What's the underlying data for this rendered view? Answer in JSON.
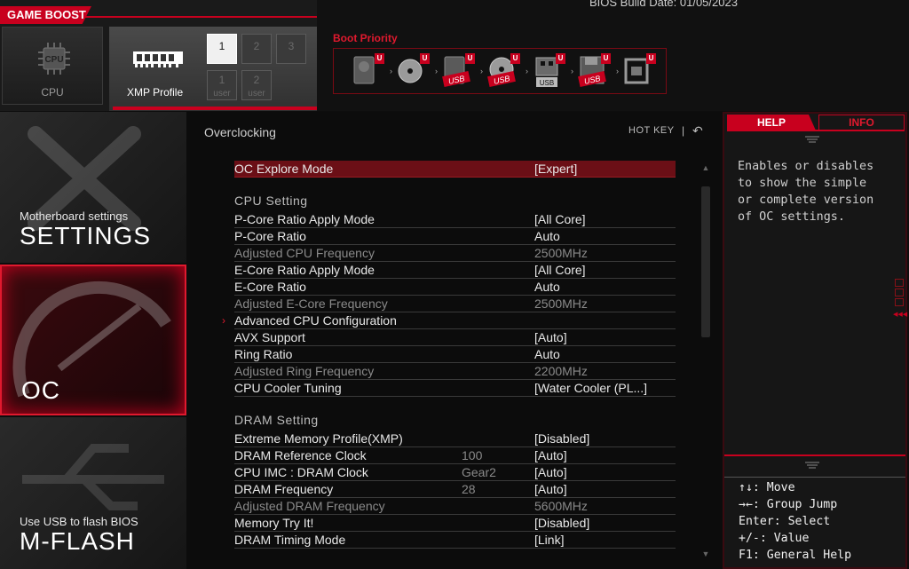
{
  "header": {
    "game_boost_label": "GAME BOOST",
    "build_date": "BIOS Build Date: 01/05/2023",
    "cpu_tile_label": "CPU",
    "cpu_chip_text": "CPU",
    "xmp_tile_label": "XMP Profile",
    "xmp_slots": [
      {
        "n": "1",
        "sub": ""
      },
      {
        "n": "2",
        "sub": ""
      },
      {
        "n": "3",
        "sub": ""
      },
      {
        "n": "1",
        "sub": "user"
      },
      {
        "n": "2",
        "sub": "user"
      }
    ],
    "boot_priority_label": "Boot Priority",
    "boot_badge": "U",
    "boot_devices": [
      {
        "icon": "hard-drive-icon",
        "tag": ""
      },
      {
        "icon": "optical-disc-icon",
        "tag": ""
      },
      {
        "icon": "usb-hard-drive-icon",
        "tag": "USB"
      },
      {
        "icon": "usb-optical-disc-icon",
        "tag": "USB"
      },
      {
        "icon": "usb-stick-icon",
        "tag": "USB"
      },
      {
        "icon": "usb-floppy-icon",
        "tag": "USB"
      },
      {
        "icon": "network-icon",
        "tag": ""
      }
    ]
  },
  "nav": {
    "settings_small": "Motherboard settings",
    "settings_big": "SETTINGS",
    "oc_big": "OC",
    "mflash_small": "Use USB to flash BIOS",
    "mflash_big": "M-FLASH"
  },
  "content": {
    "breadcrumb": "Overclocking",
    "hotkey": "HOT KEY",
    "hotkey_sep": "|",
    "back_glyph": "↶",
    "submenu_glyph": "›",
    "rows_top": [
      {
        "name": "OC Explore Mode",
        "mid": "",
        "val": "[Expert]"
      }
    ],
    "cpu_section": "CPU Setting",
    "cpu_rows": [
      {
        "name": "P-Core Ratio Apply Mode",
        "mid": "",
        "val": "[All Core]"
      },
      {
        "name": "P-Core Ratio",
        "mid": "",
        "val": "Auto"
      },
      {
        "name": "Adjusted CPU Frequency",
        "mid": "",
        "val": "2500MHz"
      },
      {
        "name": "E-Core Ratio Apply Mode",
        "mid": "",
        "val": "[All Core]"
      },
      {
        "name": "E-Core Ratio",
        "mid": "",
        "val": "Auto"
      },
      {
        "name": "Adjusted E-Core Frequency",
        "mid": "",
        "val": "2500MHz"
      },
      {
        "name": "Advanced CPU Configuration",
        "mid": "",
        "val": ""
      },
      {
        "name": "AVX Support",
        "mid": "",
        "val": "[Auto]"
      },
      {
        "name": "Ring Ratio",
        "mid": "",
        "val": "Auto"
      },
      {
        "name": "Adjusted Ring Frequency",
        "mid": "",
        "val": "2200MHz"
      },
      {
        "name": "CPU Cooler Tuning",
        "mid": "",
        "val": "[Water Cooler (PL...]"
      }
    ],
    "dram_section": "DRAM Setting",
    "dram_rows": [
      {
        "name": "Extreme Memory Profile(XMP)",
        "mid": "",
        "val": "[Disabled]"
      },
      {
        "name": "DRAM Reference Clock",
        "mid": "100",
        "val": "[Auto]"
      },
      {
        "name": "CPU IMC : DRAM Clock",
        "mid": "Gear2",
        "val": "[Auto]"
      },
      {
        "name": "DRAM Frequency",
        "mid": "28",
        "val": "[Auto]"
      },
      {
        "name": "Adjusted DRAM Frequency",
        "mid": "",
        "val": "5600MHz"
      },
      {
        "name": "Memory Try It!",
        "mid": "",
        "val": "[Disabled]"
      },
      {
        "name": "DRAM Timing Mode",
        "mid": "",
        "val": "[Link]"
      }
    ]
  },
  "help": {
    "tab_help": "HELP",
    "tab_info": "INFO",
    "text_lines": [
      "Enables or disables",
      "to show the simple",
      "or complete version",
      "of OC settings."
    ],
    "keys": [
      "↑↓: Move",
      "→←: Group Jump",
      "Enter: Select",
      "+/-: Value",
      "F1: General Help"
    ]
  },
  "colors": {
    "accent": "#c8001e",
    "selected_row": "#6b0f16",
    "dim_text": "#8a8a8a"
  }
}
